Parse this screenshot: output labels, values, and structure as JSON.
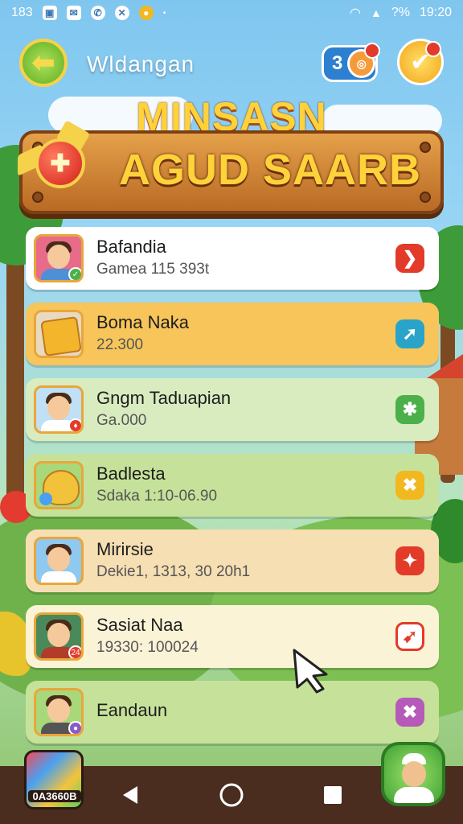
{
  "status_bar": {
    "left_text": "183",
    "icons_left": [
      "photo-icon",
      "message-icon",
      "whatsapp-icon",
      "close-icon",
      "coin-icon"
    ],
    "signal_text": "?%",
    "time": "19:20"
  },
  "header": {
    "title": "Wldangan",
    "badge_count": "3"
  },
  "banner": {
    "line1": "MINSASN",
    "line2": "AGUD SAARB"
  },
  "rows": [
    {
      "name": "Bafandia",
      "sub": "Gamea 115 393t",
      "bg": "#ffffff",
      "action_color": "#e23b2a",
      "action_glyph": "❯",
      "av_body": "#4f8fd6",
      "badge_color": "#4cb04a",
      "badge": "✓"
    },
    {
      "name": "Boma Naka",
      "sub": "22.300",
      "bg": "#f7c55a",
      "action_color": "#2aa3c9",
      "action_glyph": "➚",
      "av_body": "#e0a32b",
      "badge_color": "",
      "badge": ""
    },
    {
      "name": "Gngm Taduapian",
      "sub": "Ga.000",
      "bg": "#d9ecc0",
      "action_color": "#4cb04a",
      "action_glyph": "✱",
      "av_body": "#ffffff",
      "badge_color": "#e23b2a",
      "badge": "♦"
    },
    {
      "name": "Badlesta",
      "sub": "Sdaka 1:10-06.90",
      "bg": "#c6e29a",
      "action_color": "#f2b81f",
      "action_glyph": "✖",
      "av_body": "#f2c23a",
      "badge_color": "",
      "badge": ""
    },
    {
      "name": "Mirirsie",
      "sub": "Dekie1, 1313, 30 20h1",
      "bg": "#f6dfb3",
      "action_color": "#e23b2a",
      "action_glyph": "✦",
      "av_body": "#ffffff",
      "badge_color": "",
      "badge": ""
    },
    {
      "name": "Sasiat Naa",
      "sub": "19330: 100024",
      "bg": "#fbf3d6",
      "action_color": "#e23b2a",
      "action_glyph": "➹",
      "av_body": "#b23b2a",
      "badge_color": "#e23b2a",
      "badge": "24"
    },
    {
      "name": "Eandaun",
      "sub": "",
      "bg": "#c6e29a",
      "action_color": "#b55ab8",
      "action_glyph": "✖",
      "av_body": "#555555",
      "badge_color": "#8a5ac9",
      "badge": "●"
    }
  ],
  "bottom": {
    "app_label": "0A3660B"
  },
  "colors": {
    "accent_green": "#5fae22",
    "banner_gold": "#ffd23a",
    "nav_bg": "#4a2d1f"
  }
}
